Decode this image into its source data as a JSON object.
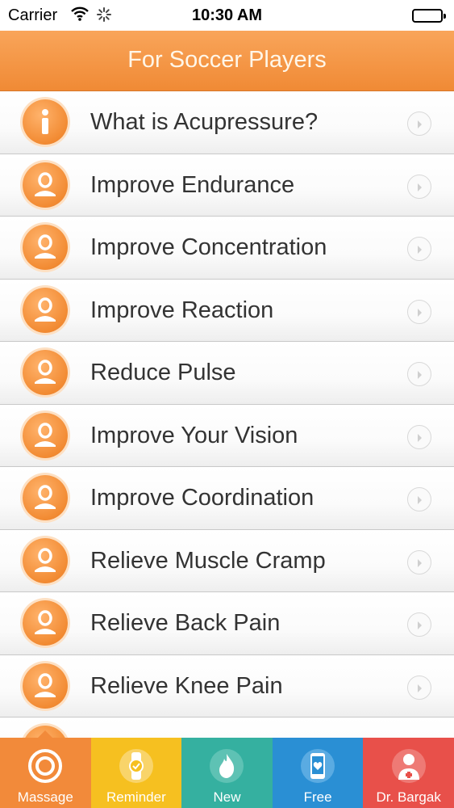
{
  "status_bar": {
    "carrier": "Carrier",
    "time": "10:30 AM"
  },
  "nav": {
    "title": "For Soccer Players"
  },
  "list": {
    "items": [
      {
        "label": "What is Acupressure?",
        "icon": "info-icon"
      },
      {
        "label": "Improve Endurance",
        "icon": "person-icon"
      },
      {
        "label": "Improve Concentration",
        "icon": "person-icon"
      },
      {
        "label": "Improve Reaction",
        "icon": "person-icon"
      },
      {
        "label": "Reduce Pulse",
        "icon": "person-icon"
      },
      {
        "label": "Improve Your Vision",
        "icon": "person-icon"
      },
      {
        "label": "Improve Coordination",
        "icon": "person-icon"
      },
      {
        "label": "Relieve Muscle Cramp",
        "icon": "person-icon"
      },
      {
        "label": "Relieve Back Pain",
        "icon": "person-icon"
      },
      {
        "label": "Relieve Knee Pain",
        "icon": "person-icon"
      },
      {
        "label": "",
        "icon": "person-icon"
      }
    ]
  },
  "tabs": [
    {
      "label": "Massage",
      "icon": "target-icon",
      "color": "#f28a3a",
      "selected": true
    },
    {
      "label": "Reminder",
      "icon": "watch-icon",
      "color": "#f6c020",
      "selected": false
    },
    {
      "label": "New",
      "icon": "flame-icon",
      "color": "#35b0a0",
      "selected": false
    },
    {
      "label": "Free",
      "icon": "phone-heart-icon",
      "color": "#2a8fd4",
      "selected": false
    },
    {
      "label": "Dr. Bargak",
      "icon": "doctor-icon",
      "color": "#e8504a",
      "selected": false
    }
  ],
  "colors": {
    "accent": "#f08a35",
    "nav_title": "#fff6e8"
  }
}
